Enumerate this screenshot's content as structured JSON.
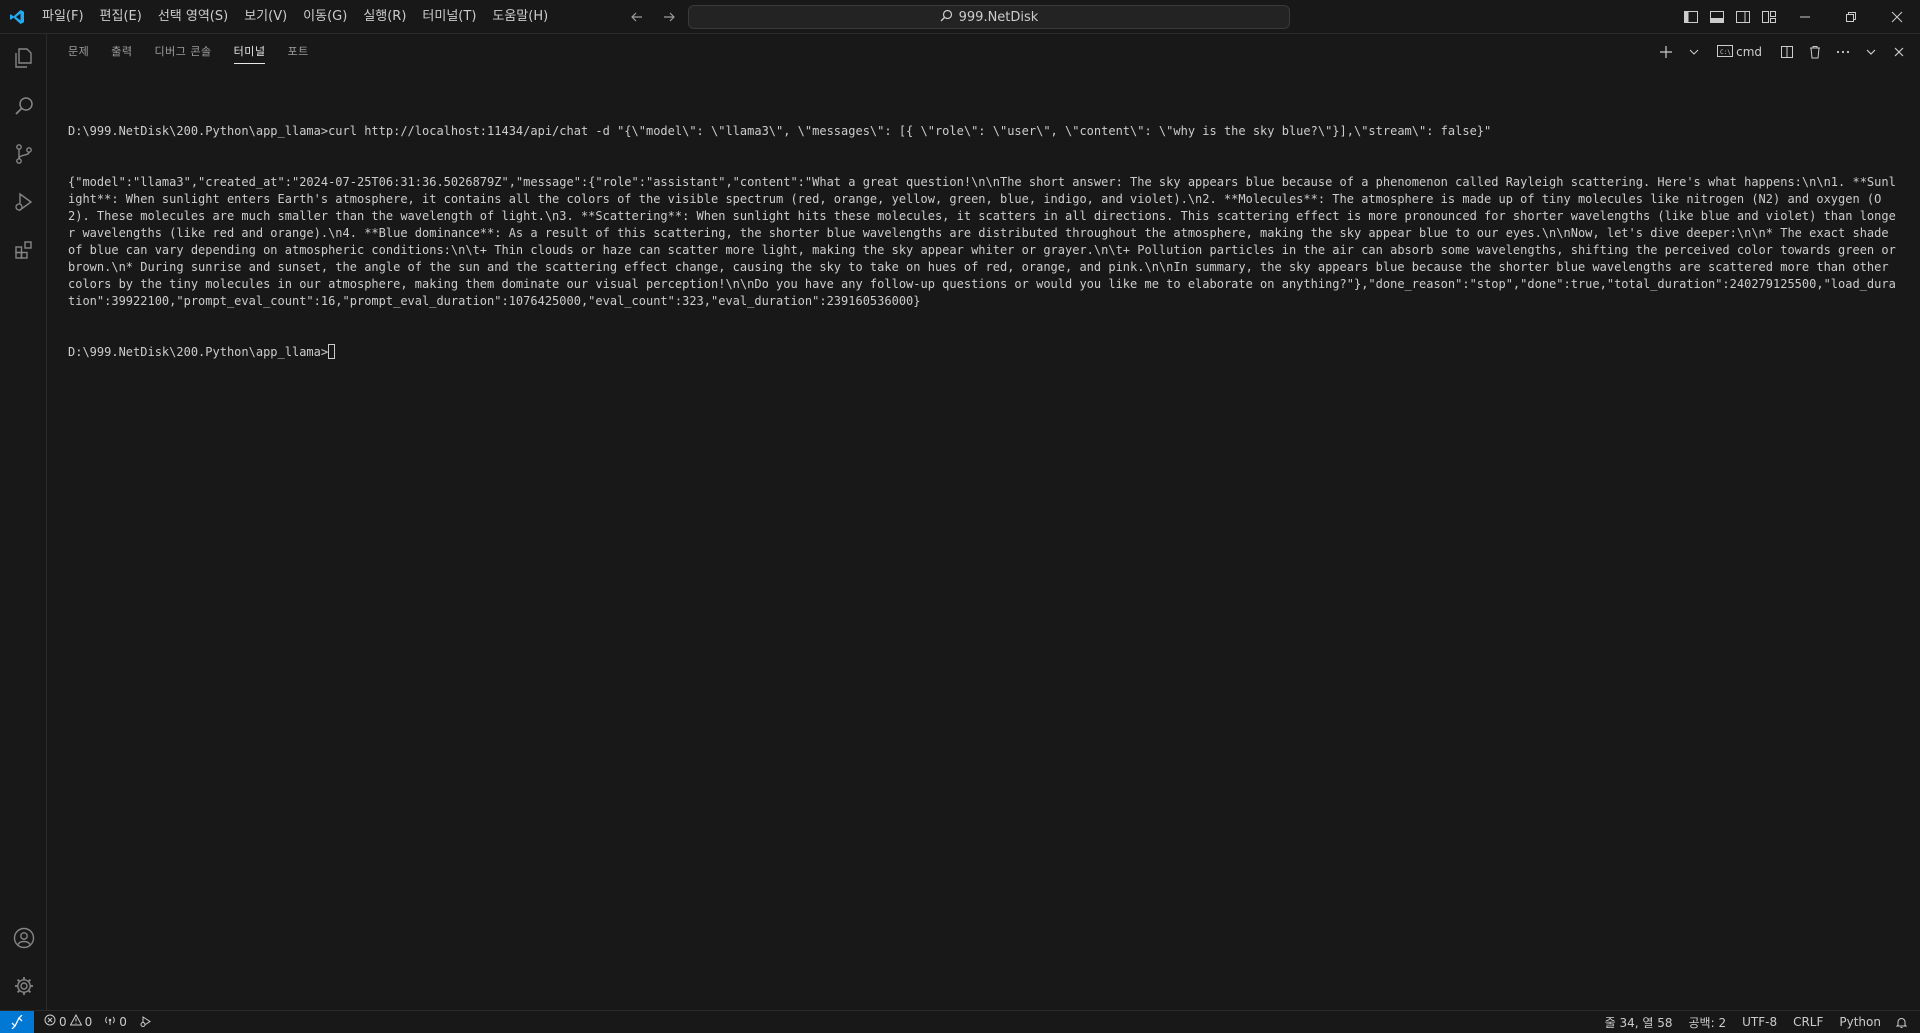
{
  "titlebar": {
    "menu": [
      "파일(F)",
      "편집(E)",
      "선택 영역(S)",
      "보기(V)",
      "이동(G)",
      "실행(R)",
      "터미널(T)",
      "도움말(H)"
    ],
    "search_text": "999.NetDisk"
  },
  "panel": {
    "tabs": [
      "문제",
      "출력",
      "디버그 콘솔",
      "터미널",
      "포트"
    ],
    "active_tab": "터미널",
    "terminal_name": "cmd"
  },
  "terminal": {
    "lines": [
      "D:\\999.NetDisk\\200.Python\\app_llama>curl http://localhost:11434/api/chat -d \"{\\\"model\\\": \\\"llama3\\\", \\\"messages\\\": [{ \\\"role\\\": \\\"user\\\", \\\"content\\\": \\\"why is the sky blue?\\\"}],\\\"stream\\\": false}\"",
      "{\"model\":\"llama3\",\"created_at\":\"2024-07-25T06:31:36.5026879Z\",\"message\":{\"role\":\"assistant\",\"content\":\"What a great question!\\n\\nThe short answer: The sky appears blue because of a phenomenon called Rayleigh scattering. Here's what happens:\\n\\n1. **Sunlight**: When sunlight enters Earth's atmosphere, it contains all the colors of the visible spectrum (red, orange, yellow, green, blue, indigo, and violet).\\n2. **Molecules**: The atmosphere is made up of tiny molecules like nitrogen (N2) and oxygen (O2). These molecules are much smaller than the wavelength of light.\\n3. **Scattering**: When sunlight hits these molecules, it scatters in all directions. This scattering effect is more pronounced for shorter wavelengths (like blue and violet) than longer wavelengths (like red and orange).\\n4. **Blue dominance**: As a result of this scattering, the shorter blue wavelengths are distributed throughout the atmosphere, making the sky appear blue to our eyes.\\n\\nNow, let's dive deeper:\\n\\n* The exact shade of blue can vary depending on atmospheric conditions:\\n\\t+ Thin clouds or haze can scatter more light, making the sky appear whiter or grayer.\\n\\t+ Pollution particles in the air can absorb some wavelengths, shifting the perceived color towards green or brown.\\n* During sunrise and sunset, the angle of the sun and the scattering effect change, causing the sky to take on hues of red, orange, and pink.\\n\\nIn summary, the sky appears blue because the shorter blue wavelengths are scattered more than other colors by the tiny molecules in our atmosphere, making them dominate our visual perception!\\n\\nDo you have any follow-up questions or would you like me to elaborate on anything?\"},\"done_reason\":\"stop\",\"done\":true,\"total_duration\":240279125500,\"load_duration\":39922100,\"prompt_eval_count\":16,\"prompt_eval_duration\":1076425000,\"eval_count\":323,\"eval_duration\":239160536000}"
    ],
    "prompt": "D:\\999.NetDisk\\200.Python\\app_llama>"
  },
  "statusbar": {
    "errors": "0",
    "warnings": "0",
    "ports": "0",
    "position": "줄 34, 열 58",
    "spaces": "공백: 2",
    "encoding": "UTF-8",
    "eol": "CRLF",
    "language": "Python"
  },
  "colors": {
    "background": "#181818",
    "accent": "#0078d4",
    "vscode_logo": "#23a9f2"
  }
}
